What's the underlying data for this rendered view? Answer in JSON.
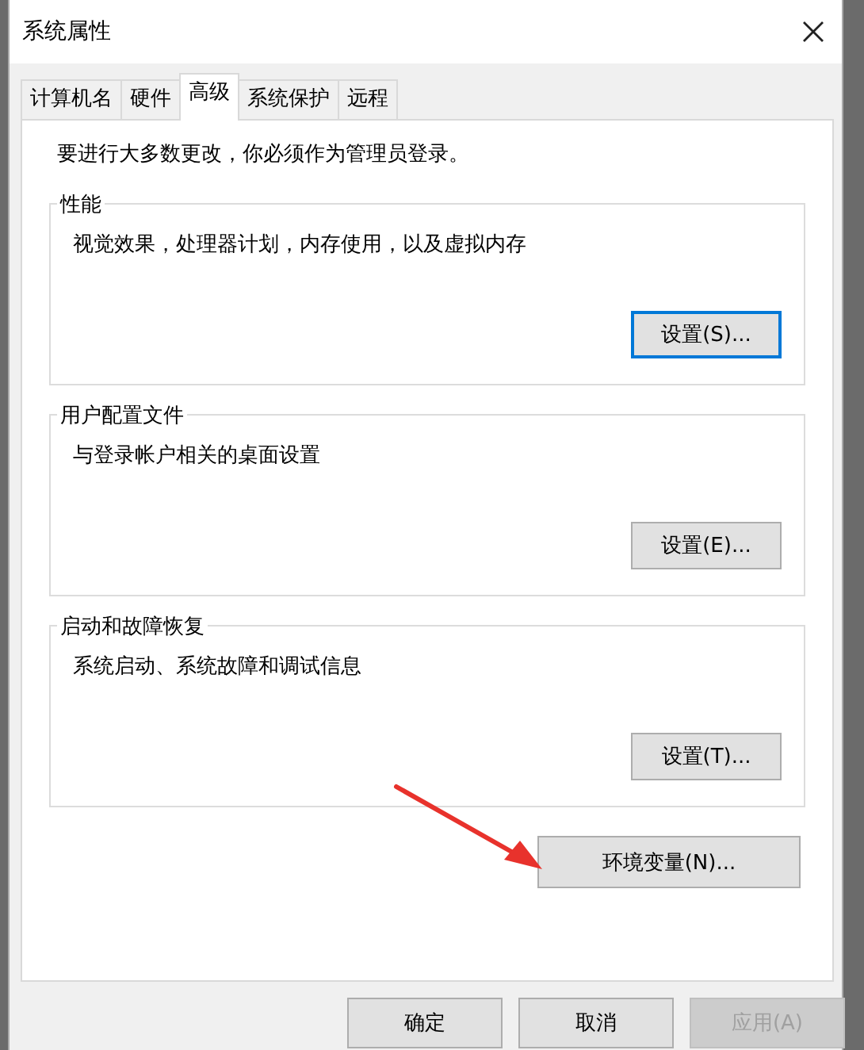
{
  "window": {
    "title": "系统属性"
  },
  "tabs": [
    {
      "label": "计算机名",
      "selected": false
    },
    {
      "label": "硬件",
      "selected": false
    },
    {
      "label": "高级",
      "selected": true
    },
    {
      "label": "系统保护",
      "selected": false
    },
    {
      "label": "远程",
      "selected": false
    }
  ],
  "notice": "要进行大多数更改，你必须作为管理员登录。",
  "groups": [
    {
      "title": "性能",
      "description": "视觉效果，处理器计划，内存使用，以及虚拟内存",
      "button": "设置(S)..."
    },
    {
      "title": "用户配置文件",
      "description": "与登录帐户相关的桌面设置",
      "button": "设置(E)..."
    },
    {
      "title": "启动和故障恢复",
      "description": "系统启动、系统故障和调试信息",
      "button": "设置(T)..."
    }
  ],
  "environment_button": "环境变量(N)...",
  "buttons": [
    {
      "label": "确定",
      "disabled": false
    },
    {
      "label": "取消",
      "disabled": false
    },
    {
      "label": "应用(A)",
      "disabled": true
    }
  ]
}
